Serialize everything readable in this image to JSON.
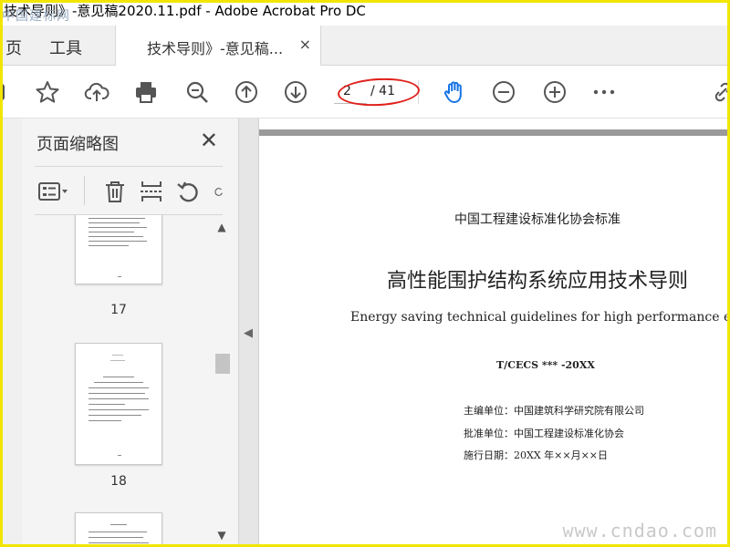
{
  "window": {
    "title": "技术导则》-意见稿2020.11.pdf - Adobe Acrobat Pro DC",
    "overlay_text": "中国建标网"
  },
  "menu": {
    "home": "页",
    "tools": "工具"
  },
  "tab": {
    "label": "技术导则》-意见稿...",
    "close": "×"
  },
  "toolbar": {
    "icons": [
      "star-icon",
      "cloud-upload-icon",
      "print-icon",
      "zoom-search-icon",
      "page-up-icon",
      "page-down-icon",
      "hand-icon",
      "zoom-out-icon",
      "zoom-in-icon",
      "more-icon",
      "link-icon"
    ],
    "page_current": "2",
    "page_total": "/ 41",
    "accent": "#1473e6",
    "annotation_color": "#e0201b"
  },
  "panel": {
    "title": "页面缩略图",
    "close": "✕",
    "thumbnails": [
      {
        "number": "17"
      },
      {
        "number": "18"
      }
    ]
  },
  "document": {
    "org_standard": "中国工程建设标准化协会标准",
    "title_cn": "高性能围护结构系统应用技术导则",
    "title_en": "Energy saving technical guidelines for high performance envelope",
    "code": "T/CECS *** -20XX",
    "chief_editor": "主编单位：中国建筑科学研究院有限公司",
    "approver": "批准单位：中国工程建设标准化协会",
    "effective_date": "施行日期：20XX 年××月××日"
  },
  "watermark": "www.cndao.com"
}
